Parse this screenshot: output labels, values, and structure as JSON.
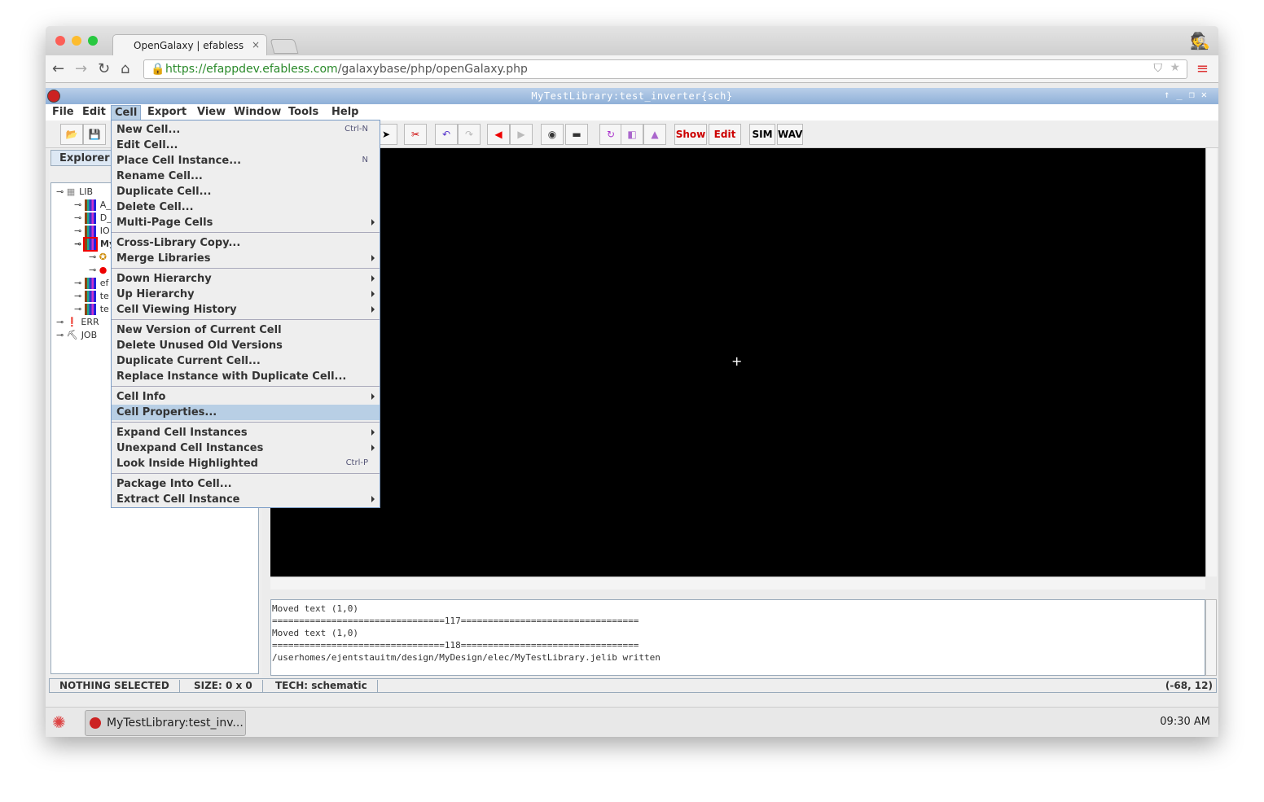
{
  "browser": {
    "tab_title": "OpenGalaxy | efabless",
    "url_host": "https://efappdev.efabless.com",
    "url_path": "/galaxybase/php/openGalaxy.php"
  },
  "app": {
    "title": "MyTestLibrary:test_inverter{sch}",
    "menubar": [
      "File",
      "Edit",
      "Cell",
      "Export",
      "View",
      "Window",
      "Tools",
      "Help"
    ],
    "active_menu": "Cell",
    "toolbar": [
      {
        "icon": "open-folder-icon"
      },
      {
        "icon": "save-icon"
      },
      {
        "icon": "select-arrow-icon"
      },
      {
        "icon": "wiring-tool-icon"
      },
      {
        "icon": "undo-icon"
      },
      {
        "icon": "redo-icon"
      },
      {
        "icon": "back-icon"
      },
      {
        "icon": "forward-icon"
      },
      {
        "icon": "eye-icon"
      },
      {
        "icon": "eye-closed-icon"
      },
      {
        "icon": "rotate-icon"
      },
      {
        "icon": "mirror-horizontal-icon"
      },
      {
        "icon": "mirror-vertical-icon"
      },
      {
        "label": "Show"
      },
      {
        "label": "Edit"
      },
      {
        "label": "SIM"
      },
      {
        "label": "WAV"
      }
    ],
    "explorer_tab": "Explorer",
    "tree": [
      "LIB",
      "A_",
      "D_",
      "IO",
      "My",
      "",
      "",
      "ef",
      "te",
      "te",
      "ERR",
      "JOB"
    ],
    "cell_menu": [
      {
        "label": "New Cell...",
        "shortcut": "Ctrl-N"
      },
      {
        "label": "Edit Cell..."
      },
      {
        "label": "Place Cell Instance...",
        "shortcut": "N"
      },
      {
        "label": "Rename Cell..."
      },
      {
        "label": "Duplicate Cell..."
      },
      {
        "label": "Delete Cell..."
      },
      {
        "label": "Multi-Page Cells",
        "submenu": true
      },
      {
        "sep": true
      },
      {
        "label": "Cross-Library Copy..."
      },
      {
        "label": "Merge Libraries",
        "submenu": true
      },
      {
        "sep": true
      },
      {
        "label": "Down Hierarchy",
        "submenu": true
      },
      {
        "label": "Up Hierarchy",
        "submenu": true
      },
      {
        "label": "Cell Viewing History",
        "submenu": true
      },
      {
        "sep": true
      },
      {
        "label": "New Version of Current Cell"
      },
      {
        "label": "Delete Unused Old Versions"
      },
      {
        "label": "Duplicate Current Cell..."
      },
      {
        "label": "Replace Instance with Duplicate Cell..."
      },
      {
        "sep": true
      },
      {
        "label": "Cell Info",
        "submenu": true
      },
      {
        "label": "Cell Properties...",
        "highlighted": true
      },
      {
        "sep": true
      },
      {
        "label": "Expand Cell Instances",
        "submenu": true
      },
      {
        "label": "Unexpand Cell Instances",
        "submenu": true
      },
      {
        "label": "Look Inside Highlighted",
        "shortcut": "Ctrl-P"
      },
      {
        "sep": true
      },
      {
        "label": "Package Into Cell..."
      },
      {
        "label": "Extract Cell Instance",
        "submenu": true
      }
    ],
    "log": [
      "Moved text (1,0)",
      "================================117=================================",
      "Moved text (1,0)",
      "================================118=================================",
      "/userhomes/ejentstauitm/design/MyDesign/elec/MyTestLibrary.jelib written"
    ],
    "status": {
      "selection": "NOTHING SELECTED",
      "size": "SIZE: 0 x 0",
      "tech": "TECH: schematic",
      "coords": "(-68, 12)"
    }
  },
  "taskbar": {
    "window_button": "MyTestLibrary:test_inv...",
    "clock": "09:30 AM"
  }
}
